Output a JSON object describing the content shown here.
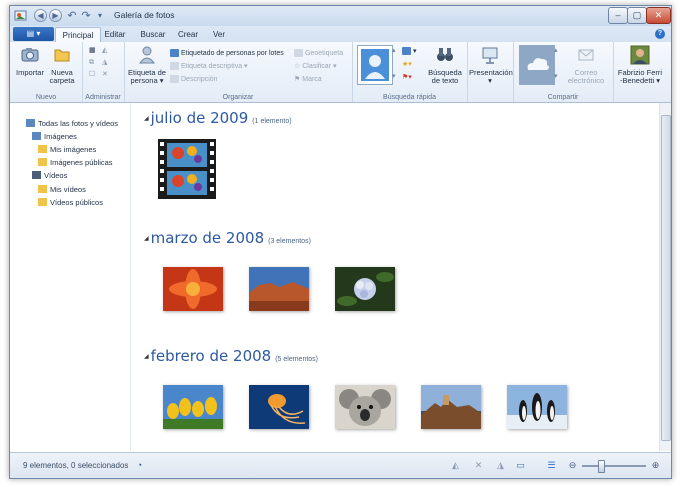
{
  "window": {
    "title": "Galería de fotos"
  },
  "tabs": [
    "Principal",
    "Editar",
    "Buscar",
    "Crear",
    "Ver"
  ],
  "ribbon": {
    "nuevo": {
      "label": "Nuevo",
      "import": "Importar",
      "new_folder_1": "Nueva",
      "new_folder_2": "carpeta"
    },
    "administrar": {
      "label": "Administrar"
    },
    "organizar": {
      "label": "Organizar",
      "people_tag_1": "Etiqueta de",
      "people_tag_2": "persona ▾",
      "tag_people": "Etiquetado de personas por lotes",
      "descriptive_tag": "Etiqueta descriptiva ▾",
      "description": "Descripción",
      "geotag": "Geoetiqueta",
      "rate": "Clasificar ▾",
      "flag": "Marca"
    },
    "busqueda": {
      "label": "Búsqueda rápida",
      "text_search_1": "Búsqueda",
      "text_search_2": "de texto"
    },
    "presentacion": {
      "label": "Presentación ▾"
    },
    "compartir": {
      "label": "Compartir",
      "email_1": "Correo",
      "email_2": "electrónico",
      "user_1": "Fabrizio Ferri",
      "user_2": "-Benedetti ▾"
    }
  },
  "nav": [
    {
      "label": "Todas las fotos y vídeos"
    },
    {
      "label": "Imágenes"
    },
    {
      "label": "Mis imágenes"
    },
    {
      "label": "Imágenes públicas"
    },
    {
      "label": "Vídeos"
    },
    {
      "label": "Mis vídeos"
    },
    {
      "label": "Vídeos públicos"
    }
  ],
  "groups": [
    {
      "title": "julio de 2009",
      "count": "(1 elemento)"
    },
    {
      "title": "marzo de 2008",
      "count": "(3 elementos)"
    },
    {
      "title": "febrero de 2008",
      "count": "(5 elementos)"
    }
  ],
  "status": {
    "text": "9 elementos, 0 seleccionados"
  },
  "colors": {
    "accent": "#2c5aa0",
    "file_button": "#1c55a6",
    "close_button": "#c74a34"
  }
}
